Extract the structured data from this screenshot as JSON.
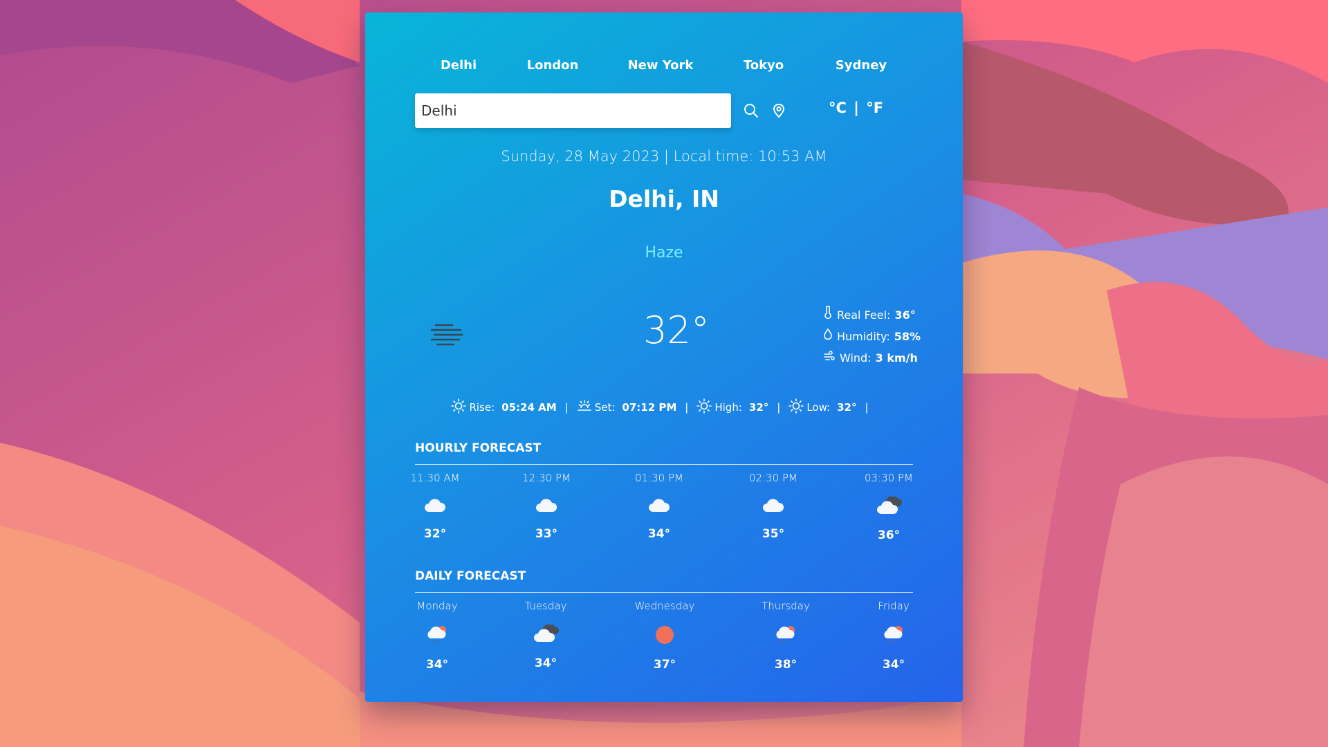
{
  "cities": [
    "Delhi",
    "London",
    "New York",
    "Tokyo",
    "Sydney"
  ],
  "search": {
    "value": "Delhi"
  },
  "units": {
    "celsius": "°C",
    "separator": "|",
    "fahrenheit": "°F"
  },
  "date_line": "Sunday, 28 May 2023 | Local time: 10:53 AM",
  "location": "Delhi, IN",
  "condition": "Haze",
  "condition_icon": "haze-icon",
  "temperature": "32°",
  "details": {
    "real_feel_label": "Real Feel:",
    "real_feel": "36°",
    "humidity_label": "Humidity:",
    "humidity": "58%",
    "wind_label": "Wind:",
    "wind": "3 km/h"
  },
  "sun": {
    "rise_label": "Rise:",
    "rise": "05:24 AM",
    "set_label": "Set:",
    "set": "07:12 PM",
    "high_label": "High:",
    "high": "32°",
    "low_label": "Low:",
    "low": "32°",
    "separator": "|"
  },
  "hourly": {
    "title": "HOURLY FORECAST",
    "items": [
      {
        "label": "11:30 AM",
        "icon": "cloud-icon",
        "temp": "32°"
      },
      {
        "label": "12:30 PM",
        "icon": "cloud-icon",
        "temp": "33°"
      },
      {
        "label": "01:30 PM",
        "icon": "cloud-icon",
        "temp": "34°"
      },
      {
        "label": "02:30 PM",
        "icon": "cloud-icon",
        "temp": "35°"
      },
      {
        "label": "03:30 PM",
        "icon": "broken-clouds-icon",
        "temp": "36°"
      }
    ]
  },
  "daily": {
    "title": "DAILY FORECAST",
    "items": [
      {
        "label": "Monday",
        "icon": "sun-rain-cloud-icon",
        "temp": "34°"
      },
      {
        "label": "Tuesday",
        "icon": "broken-clouds-icon",
        "temp": "34°"
      },
      {
        "label": "Wednesday",
        "icon": "sun-icon",
        "temp": "37°"
      },
      {
        "label": "Thursday",
        "icon": "sun-rain-cloud-icon",
        "temp": "38°"
      },
      {
        "label": "Friday",
        "icon": "sun-rain-cloud-icon",
        "temp": "34°"
      }
    ]
  },
  "colors": {
    "card_gradient_start": "#08b5d8",
    "card_gradient_end": "#2563eb",
    "condition_text": "#7ff0ff",
    "sun_orange": "#f0705a"
  }
}
